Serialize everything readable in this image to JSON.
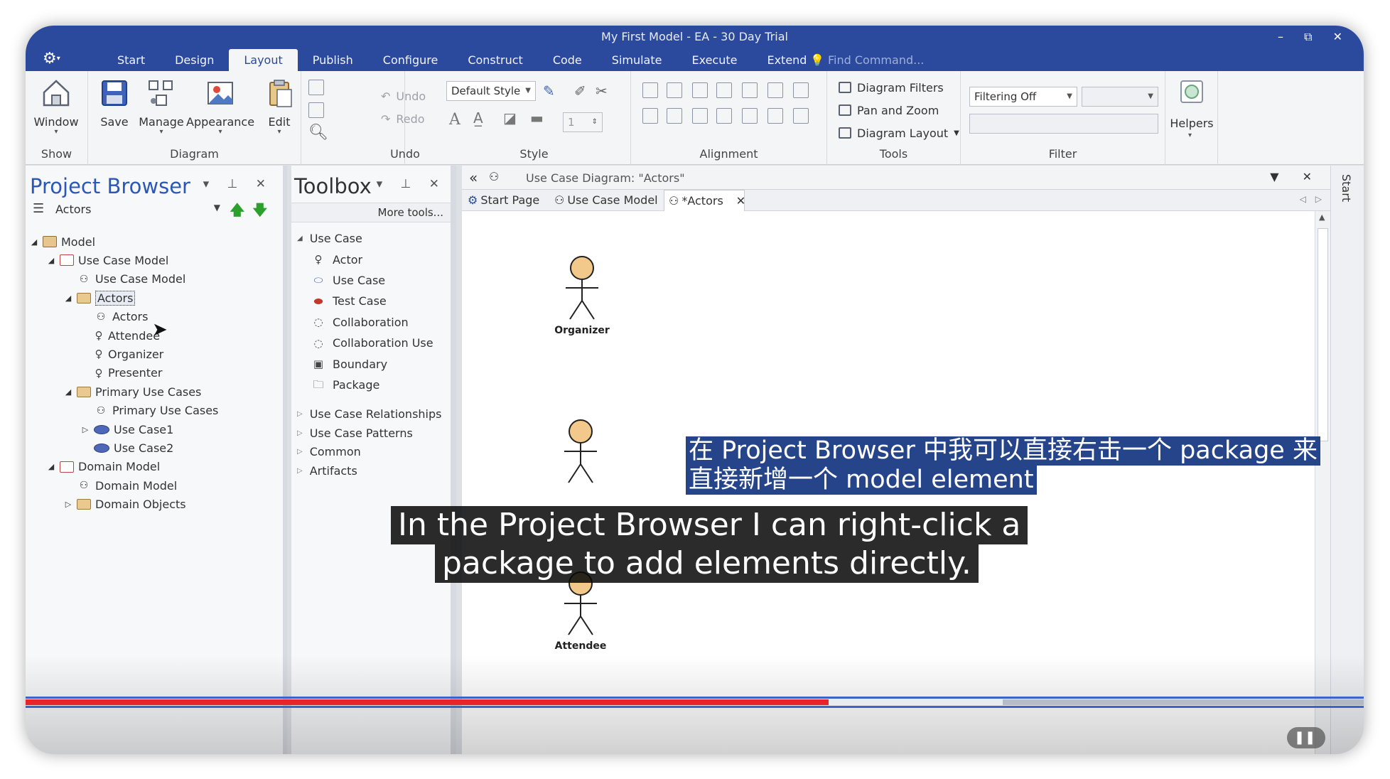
{
  "app": {
    "title": "My First Model - EA - 30 Day Trial",
    "app_menu_icon": "ea-logo-icon",
    "window_controls": "–  ⧉  ✕"
  },
  "ribbon": {
    "tabs": [
      "Start",
      "Design",
      "Layout",
      "Publish",
      "Configure",
      "Construct",
      "Code",
      "Simulate",
      "Execute",
      "Extend"
    ],
    "active_tab": "Layout",
    "find_command": "Find Command...",
    "groups": {
      "show": {
        "label": "Show",
        "window": "Window"
      },
      "diagram": {
        "label": "Diagram",
        "save": "Save",
        "manage": "Manage",
        "appearance": "Appearance",
        "edit": "Edit"
      },
      "undo": {
        "label": "Undo",
        "undo": "Undo",
        "redo": "Redo"
      },
      "style": {
        "label": "Style",
        "default_style": "Default Style",
        "line_width": "1"
      },
      "alignment": {
        "label": "Alignment"
      },
      "tools": {
        "label": "Tools",
        "diagram_filters": "Diagram Filters",
        "pan_zoom": "Pan and Zoom",
        "diagram_layout": "Diagram Layout"
      },
      "filter": {
        "label": "Filter",
        "filtering": "Filtering Off"
      },
      "helpers": {
        "label": "Helpers"
      }
    }
  },
  "project_browser": {
    "title": "Project Browser",
    "current": "Actors",
    "tree": [
      {
        "label": "Model",
        "icon": "model",
        "depth": 0,
        "twisty": "◢"
      },
      {
        "label": "Use Case Model",
        "icon": "package",
        "depth": 1,
        "twisty": "◢"
      },
      {
        "label": "Use Case Model",
        "icon": "diagram",
        "depth": 2,
        "twisty": ""
      },
      {
        "label": "Actors",
        "icon": "folder",
        "depth": 2,
        "twisty": "◢",
        "selected": true
      },
      {
        "label": "Actors",
        "icon": "diagram",
        "depth": 3,
        "twisty": ""
      },
      {
        "label": "Attendee",
        "icon": "actor",
        "depth": 3,
        "twisty": ""
      },
      {
        "label": "Organizer",
        "icon": "actor",
        "depth": 3,
        "twisty": ""
      },
      {
        "label": "Presenter",
        "icon": "actor",
        "depth": 3,
        "twisty": ""
      },
      {
        "label": "Primary Use Cases",
        "icon": "folder",
        "depth": 2,
        "twisty": "◢"
      },
      {
        "label": "Primary Use Cases",
        "icon": "diagram",
        "depth": 3,
        "twisty": ""
      },
      {
        "label": "Use Case1",
        "icon": "usecase",
        "depth": 3,
        "twisty": "▷"
      },
      {
        "label": "Use Case2",
        "icon": "usecase",
        "depth": 3,
        "twisty": ""
      },
      {
        "label": "Domain Model",
        "icon": "package",
        "depth": 1,
        "twisty": "◢"
      },
      {
        "label": "Domain Model",
        "icon": "diagram",
        "depth": 2,
        "twisty": ""
      },
      {
        "label": "Domain Objects",
        "icon": "folder",
        "depth": 2,
        "twisty": "▷"
      }
    ]
  },
  "toolbox": {
    "title": "Toolbox",
    "more_tools": "More tools...",
    "section": "Use Case",
    "items": [
      {
        "label": "Actor",
        "icon": "actor-icon"
      },
      {
        "label": "Use Case",
        "icon": "use-case-icon"
      },
      {
        "label": "Test Case",
        "icon": "test-case-icon"
      },
      {
        "label": "Collaboration",
        "icon": "collaboration-icon"
      },
      {
        "label": "Collaboration Use",
        "icon": "collaboration-use-icon"
      },
      {
        "label": "Boundary",
        "icon": "boundary-icon"
      },
      {
        "label": "Package",
        "icon": "package-icon"
      }
    ],
    "groups": [
      "Use Case Relationships",
      "Use Case Patterns",
      "Common",
      "Artifacts"
    ]
  },
  "diagram": {
    "header_title": "Use Case Diagram: \"Actors\"",
    "tabs": [
      "Start Page",
      "Use Case Model",
      "*Actors"
    ],
    "active_tab": "*Actors",
    "actors": [
      "Organizer",
      "Attendee"
    ]
  },
  "right_strip": {
    "label": "Start"
  },
  "video": {
    "progress": 0.6,
    "buffered": 0.73,
    "subtitle_zh_line1": "在 Project Browser 中我可以直接右击一个 package 来",
    "subtitle_zh_line2": "直接新增一个 model element",
    "subtitle_en_line1": "In the Project Browser I can right-click a",
    "subtitle_en_line2": "package to add elements directly.",
    "pause_icon": "pause-icon"
  },
  "colors": {
    "title_bar": "#2b4a9e",
    "accent_blue": "#2b58b8",
    "progress_red": "#e8232a",
    "actor_head": "#f2c98a"
  }
}
